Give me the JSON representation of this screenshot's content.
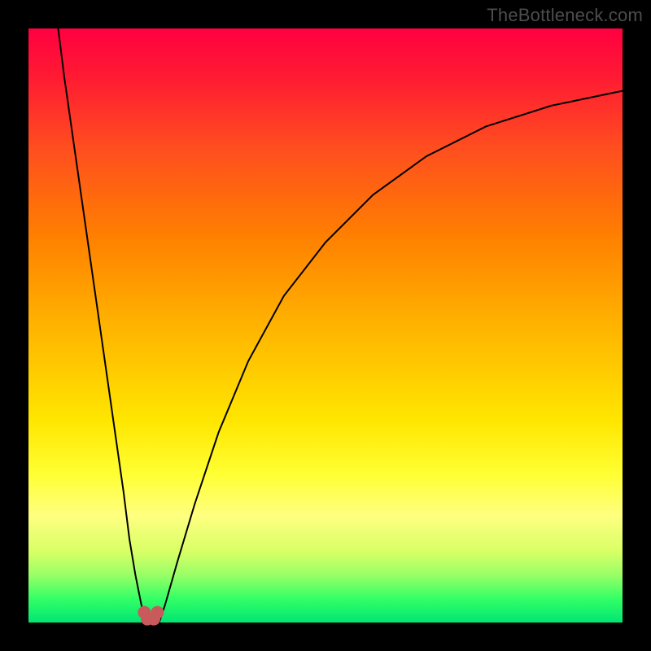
{
  "watermark": "TheBottleneck.com",
  "chart_data": {
    "type": "line",
    "title": "",
    "xlabel": "",
    "ylabel": "",
    "xlim": [
      0,
      100
    ],
    "ylim": [
      0,
      100
    ],
    "grid": false,
    "series": [
      {
        "name": "left-curve",
        "x": [
          5,
          6,
          8,
          10,
          12,
          14,
          16,
          17,
          18,
          19,
          19.8
        ],
        "values": [
          100,
          92,
          78,
          64,
          50,
          36,
          22,
          14,
          8,
          3,
          0
        ]
      },
      {
        "name": "right-curve",
        "x": [
          22,
          23,
          25,
          28,
          32,
          37,
          43,
          50,
          58,
          67,
          77,
          88,
          100
        ],
        "values": [
          0,
          3,
          10,
          20,
          32,
          44,
          55,
          64,
          72,
          78.5,
          83.5,
          87,
          89.5
        ]
      }
    ],
    "markers": {
      "name": "bottom-markers",
      "points": [
        {
          "x": 19.5,
          "y": 1.7
        },
        {
          "x": 20.0,
          "y": 0.6
        },
        {
          "x": 21.1,
          "y": 0.6
        },
        {
          "x": 21.7,
          "y": 1.7
        }
      ],
      "radius_px": 7.5,
      "color": "#c85a5c"
    },
    "gradient_stops": [
      {
        "pos": 0.0,
        "color": "#ff0040"
      },
      {
        "pos": 0.08,
        "color": "#ff1a33"
      },
      {
        "pos": 0.2,
        "color": "#ff4d1f"
      },
      {
        "pos": 0.35,
        "color": "#ff8000"
      },
      {
        "pos": 0.5,
        "color": "#ffb300"
      },
      {
        "pos": 0.66,
        "color": "#ffe600"
      },
      {
        "pos": 0.75,
        "color": "#ffff33"
      },
      {
        "pos": 0.82,
        "color": "#ffff80"
      },
      {
        "pos": 0.88,
        "color": "#d9ff66"
      },
      {
        "pos": 0.92,
        "color": "#99ff66"
      },
      {
        "pos": 0.96,
        "color": "#33ff66"
      },
      {
        "pos": 1.0,
        "color": "#00e673"
      }
    ]
  }
}
